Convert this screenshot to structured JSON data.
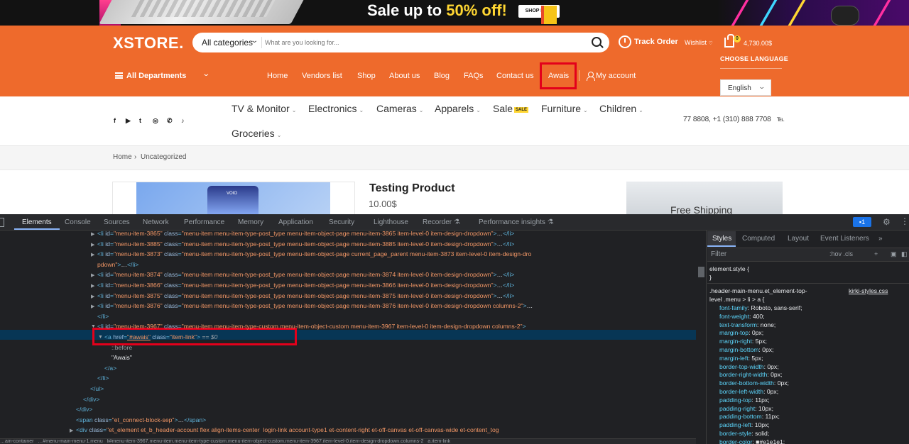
{
  "promo": {
    "sale_text": "Sale up to ",
    "sale_pct": "50% off!",
    "shop_now": "SHOP NOW"
  },
  "header": {
    "logo": "XSTORE.",
    "search": {
      "category": "All categories",
      "placeholder": "What are you looking for..."
    },
    "track_order": "Track Order",
    "wishlist": "Wishlist",
    "cart_count": "0",
    "cart_amount": "4,730.00$",
    "choose_language": "CHOOSE LANGUAGE",
    "language": "English",
    "all_departments": "All Departments",
    "nav": [
      "Home",
      "Vendors list",
      "Shop",
      "About us",
      "Blog",
      "FAQs",
      "Contact us",
      "Awais"
    ],
    "my_account": "My account"
  },
  "categories": {
    "social_icons": [
      "facebook-icon",
      "youtube-icon",
      "twitter-icon",
      "instagram-icon",
      "whatsapp-icon",
      "tiktok-icon"
    ],
    "items": [
      "TV & Monitor",
      "Electronics",
      "Cameras",
      "Apparels",
      "Sale",
      "Furniture",
      "Children",
      "Groceries"
    ],
    "sale_tag": "SALE",
    "phone": "77 8808, +1 (310) 888 7708"
  },
  "breadcrumb": {
    "home": "Home",
    "sep": "›",
    "current": "Uncategorized"
  },
  "product": {
    "image_label": "VOIO",
    "title": "Testing Product",
    "price": "10.00$",
    "side_banner": "Free Shipping"
  },
  "devtools": {
    "tabs": [
      "Elements",
      "Console",
      "Sources",
      "Network",
      "Performance",
      "Memory",
      "Application",
      "Security",
      "Lighthouse",
      "Recorder",
      "Performance insights"
    ],
    "issues_count": "1",
    "styles_tabs": [
      "Styles",
      "Computed",
      "Layout",
      "Event Listeners"
    ],
    "filter_placeholder": "Filter",
    "filter_tools": ":hov .cls",
    "dom_lines": [
      {
        "tri": "▶",
        "indent": 137,
        "parts": [
          [
            "tag",
            "<li "
          ],
          [
            "an",
            "id"
          ],
          [
            "tag",
            "="
          ],
          [
            "av",
            "\"menu-item-3865\""
          ],
          [
            "an",
            " class"
          ],
          [
            "tag",
            "="
          ],
          [
            "av",
            "\"menu-item menu-item-type-post_type menu-item-object-page menu-item-3865 item-level-0 item-design-dropdown\""
          ],
          [
            "tag",
            ">"
          ],
          [
            "txt",
            "…"
          ],
          [
            "tag",
            "</li>"
          ]
        ]
      },
      {
        "tri": "▶",
        "indent": 137,
        "parts": [
          [
            "tag",
            "<li "
          ],
          [
            "an",
            "id"
          ],
          [
            "tag",
            "="
          ],
          [
            "av",
            "\"menu-item-3885\""
          ],
          [
            "an",
            " class"
          ],
          [
            "tag",
            "="
          ],
          [
            "av",
            "\"menu-item menu-item-type-post_type menu-item-object-page menu-item-3885 item-level-0 item-design-dropdown\""
          ],
          [
            "tag",
            ">"
          ],
          [
            "txt",
            "…"
          ],
          [
            "tag",
            "</li>"
          ]
        ]
      },
      {
        "tri": "▶",
        "indent": 137,
        "parts": [
          [
            "tag",
            "<li "
          ],
          [
            "an",
            "id"
          ],
          [
            "tag",
            "="
          ],
          [
            "av",
            "\"menu-item-3873\""
          ],
          [
            "an",
            " class"
          ],
          [
            "tag",
            "="
          ],
          [
            "av",
            "\"menu-item menu-item-type-post_type menu-item-object-page current_page_parent menu-item-3873 item-level-0 item-design-dro"
          ]
        ]
      },
      {
        "tri": "",
        "indent": 137,
        "parts": [
          [
            "av",
            "pdown\""
          ],
          [
            "tag",
            ">"
          ],
          [
            "txt",
            "…"
          ],
          [
            "tag",
            "</li>"
          ]
        ]
      },
      {
        "tri": "▶",
        "indent": 137,
        "parts": [
          [
            "tag",
            "<li "
          ],
          [
            "an",
            "id"
          ],
          [
            "tag",
            "="
          ],
          [
            "av",
            "\"menu-item-3874\""
          ],
          [
            "an",
            " class"
          ],
          [
            "tag",
            "="
          ],
          [
            "av",
            "\"menu-item menu-item-type-post_type menu-item-object-page menu-item-3874 item-level-0 item-design-dropdown\""
          ],
          [
            "tag",
            ">"
          ],
          [
            "txt",
            "…"
          ],
          [
            "tag",
            "</li>"
          ]
        ]
      },
      {
        "tri": "▶",
        "indent": 137,
        "parts": [
          [
            "tag",
            "<li "
          ],
          [
            "an",
            "id"
          ],
          [
            "tag",
            "="
          ],
          [
            "av",
            "\"menu-item-3866\""
          ],
          [
            "an",
            " class"
          ],
          [
            "tag",
            "="
          ],
          [
            "av",
            "\"menu-item menu-item-type-post_type menu-item-object-page menu-item-3866 item-level-0 item-design-dropdown\""
          ],
          [
            "tag",
            ">"
          ],
          [
            "txt",
            "…"
          ],
          [
            "tag",
            "</li>"
          ]
        ]
      },
      {
        "tri": "▶",
        "indent": 137,
        "parts": [
          [
            "tag",
            "<li "
          ],
          [
            "an",
            "id"
          ],
          [
            "tag",
            "="
          ],
          [
            "av",
            "\"menu-item-3875\""
          ],
          [
            "an",
            " class"
          ],
          [
            "tag",
            "="
          ],
          [
            "av",
            "\"menu-item menu-item-type-post_type menu-item-object-page menu-item-3875 item-level-0 item-design-dropdown\""
          ],
          [
            "tag",
            ">"
          ],
          [
            "txt",
            "…"
          ],
          [
            "tag",
            "</li>"
          ]
        ]
      },
      {
        "tri": "▶",
        "indent": 137,
        "parts": [
          [
            "tag",
            "<li "
          ],
          [
            "an",
            "id"
          ],
          [
            "tag",
            "="
          ],
          [
            "av",
            "\"menu-item-3876\""
          ],
          [
            "an",
            " class"
          ],
          [
            "tag",
            "="
          ],
          [
            "av",
            "\"menu-item menu-item-type-post_type menu-item-object-page menu-item-3876 item-level-0 item-design-dropdown columns-2\""
          ],
          [
            "tag",
            ">"
          ],
          [
            "txt",
            "…"
          ]
        ]
      },
      {
        "tri": "",
        "indent": 137,
        "parts": [
          [
            "tag",
            "</li>"
          ]
        ]
      },
      {
        "tri": "▼",
        "indent": 137,
        "parts": [
          [
            "tag",
            "<li "
          ],
          [
            "an",
            "id"
          ],
          [
            "tag",
            "="
          ],
          [
            "av",
            "\"menu-item-3967\""
          ],
          [
            "an",
            " class"
          ],
          [
            "tag",
            "="
          ],
          [
            "av",
            "\"menu-item menu-item-type-custom menu-item-object-custom menu-item-3967 item-level-0 item-design-dropdown columns-2\""
          ],
          [
            "tag",
            ">"
          ]
        ]
      },
      {
        "tri": "▼",
        "indent": 147,
        "parts": [
          [
            "tag",
            "<a "
          ],
          [
            "an",
            "href"
          ],
          [
            "tag",
            "="
          ],
          [
            "av",
            "\"#awais\""
          ],
          [
            "an",
            " class"
          ],
          [
            "tag",
            "="
          ],
          [
            "av",
            "\"item-link\""
          ],
          [
            "tag",
            ">"
          ],
          [
            "txt",
            " == $0"
          ]
        ]
      },
      {
        "tri": "",
        "indent": 157,
        "parts": [
          [
            "txt",
            "::before"
          ]
        ]
      },
      {
        "tri": "",
        "indent": 157,
        "parts": [
          [
            "txt",
            "\"Awais\""
          ]
        ]
      },
      {
        "tri": "",
        "indent": 147,
        "parts": [
          [
            "tag",
            "</a>"
          ]
        ]
      },
      {
        "tri": "",
        "indent": 137,
        "parts": [
          [
            "tag",
            "</li>"
          ]
        ]
      },
      {
        "tri": "",
        "indent": 127,
        "parts": [
          [
            "tag",
            "</ul>"
          ]
        ]
      },
      {
        "tri": "",
        "indent": 117,
        "parts": [
          [
            "tag",
            "</div>"
          ]
        ]
      },
      {
        "tri": "",
        "indent": 107,
        "parts": [
          [
            "tag",
            "</div>"
          ]
        ]
      },
      {
        "tri": "",
        "indent": 107,
        "parts": [
          [
            "tag",
            "<span "
          ],
          [
            "an",
            "class"
          ],
          [
            "tag",
            "="
          ],
          [
            "av",
            "\"et_connect-block-sep\""
          ],
          [
            "tag",
            ">"
          ],
          [
            "txt",
            "…"
          ],
          [
            "tag",
            "</span>"
          ]
        ]
      },
      {
        "tri": "▶",
        "indent": 107,
        "parts": [
          [
            "tag",
            "<div "
          ],
          [
            "an",
            "class"
          ],
          [
            "tag",
            "="
          ],
          [
            "av",
            "\"et_element et_b_header-account flex align-items-center  login-link account-type1 et-content-right et-off-canvas et-off-canvas-wide et-content_tog"
          ]
        ]
      }
    ],
    "style_rule": {
      "element_style": "element.style {",
      "close": "}",
      "selector": ".header-main-menu.et_element-top-",
      "selector2": "level .menu > li > a {",
      "source": "kirki-styles.css",
      "props": [
        [
          "font-family",
          "Roboto, sans-serif;"
        ],
        [
          "font-weight",
          "400;"
        ],
        [
          "text-transform",
          "none;"
        ],
        [
          "margin-top",
          "0px;"
        ],
        [
          "margin-right",
          "5px;"
        ],
        [
          "margin-bottom",
          "0px;"
        ],
        [
          "margin-left",
          "5px;"
        ],
        [
          "border-top-width",
          "0px;"
        ],
        [
          "border-right-width",
          "0px;"
        ],
        [
          "border-bottom-width",
          "0px;"
        ],
        [
          "border-left-width",
          "0px;"
        ],
        [
          "padding-top",
          "11px;"
        ],
        [
          "padding-right",
          "10px;"
        ],
        [
          "padding-bottom",
          "11px;"
        ],
        [
          "padding-left",
          "10px;"
        ],
        [
          "border-style",
          "solid;"
        ],
        [
          "border-color",
          "#e1e1e1;"
        ]
      ]
    },
    "breadcrumb_bar": "…ain-container   …#menu-main-menu-1.menu   li#menu-item-3967.menu-item.menu-item-type-custom.menu-item-object-custom.menu-item-3967.item-level-0.item-design-dropdown.columns-2   a.item-link"
  }
}
